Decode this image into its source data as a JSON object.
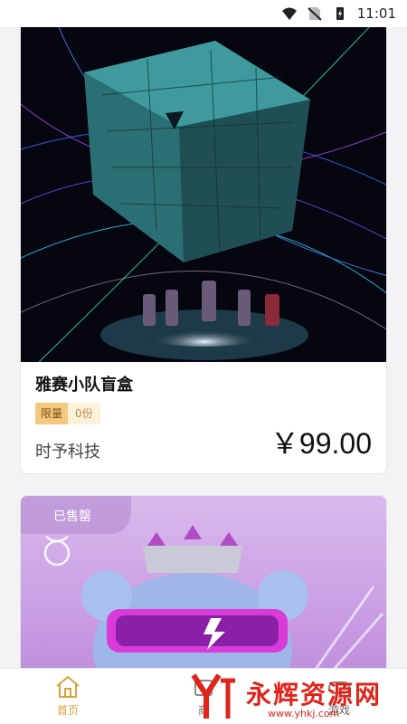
{
  "status_bar": {
    "time": "11:01"
  },
  "products": [
    {
      "title": "雅赛小队盲盒",
      "tag_label": "限量",
      "tag_count": "0份",
      "brand": "时予科技",
      "price": "￥99.00"
    },
    {
      "sold_out_label": "已售罄"
    }
  ],
  "bottom_nav": {
    "items": [
      {
        "label": "首页",
        "active": true
      },
      {
        "label": "商",
        "active": false
      },
      {
        "label": "游戏",
        "active": false
      }
    ]
  },
  "watermark": {
    "text": "永辉资源网",
    "url": "www.yhkj.com",
    "color": "#e0241a"
  },
  "accent_color": "#d9a23a"
}
